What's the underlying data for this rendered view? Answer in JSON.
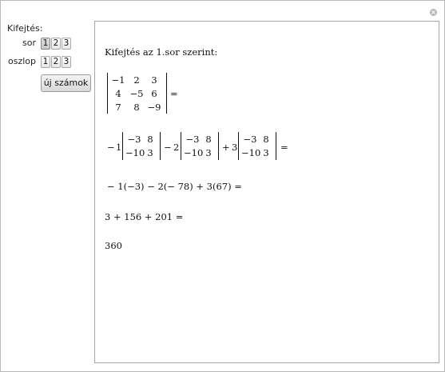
{
  "controls": {
    "expansion_label": "Kifejtés:",
    "row_label": "sor",
    "column_label": "oszlop",
    "row_options": [
      "1",
      "2",
      "3"
    ],
    "row_selected": "1",
    "column_options": [
      "1",
      "2",
      "3"
    ],
    "new_numbers_label": "új számok"
  },
  "output": {
    "heading": "Kifejtés az 1.sor szerint:",
    "matrix": [
      [
        "−1",
        "2",
        "3"
      ],
      [
        "4",
        "−5",
        "6"
      ],
      [
        "7",
        "8",
        "−9"
      ]
    ],
    "equals": "=",
    "expansion_terms": [
      {
        "sign": "−",
        "coef": "1",
        "minor": [
          [
            "−3",
            "8"
          ],
          [
            "−10",
            "3"
          ]
        ]
      },
      {
        "sign": "−",
        "coef": "2",
        "minor": [
          [
            "−3",
            "8"
          ],
          [
            "−10",
            "3"
          ]
        ]
      },
      {
        "sign": "+",
        "coef": "3",
        "minor": [
          [
            "−3",
            "8"
          ],
          [
            "−10",
            "3"
          ]
        ]
      }
    ],
    "line_products": "− 1(−3) − 2(− 78) + 3(67) =",
    "line_sums": "3 + 156 + 201 =",
    "result": "360"
  }
}
